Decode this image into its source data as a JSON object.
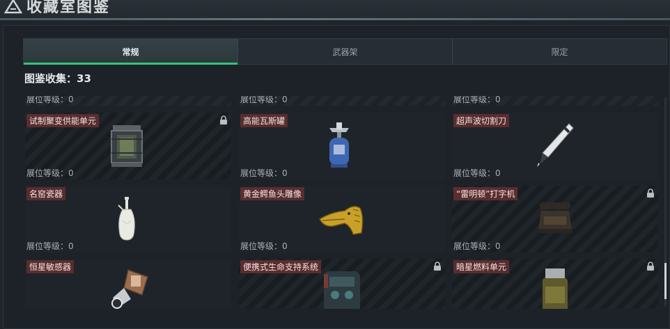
{
  "header": {
    "title": "收藏室图鉴"
  },
  "tabs": [
    {
      "label": "常规",
      "active": true
    },
    {
      "label": "武器架",
      "active": false
    },
    {
      "label": "限定",
      "active": false
    }
  ],
  "collection_count": "图鉴收集：33",
  "level_prefix": "展位等级：",
  "accent_color": "#36c47d",
  "label_color": "#5a2d2e",
  "partial_row": [
    {
      "level": "0"
    },
    {
      "level": "0"
    },
    {
      "level": "0"
    }
  ],
  "items": [
    {
      "name": "试制聚变供能单元",
      "level": "0",
      "locked": true,
      "icon": "fusion-power-unit-icon"
    },
    {
      "name": "高能瓦斯罐",
      "level": "0",
      "locked": false,
      "icon": "gas-canister-icon"
    },
    {
      "name": "超声波切割刀",
      "level": "0",
      "locked": false,
      "icon": "ultrasonic-cutter-icon"
    },
    {
      "name": "名窑瓷器",
      "level": "0",
      "locked": false,
      "icon": "porcelain-vase-icon"
    },
    {
      "name": "黄金鳄鱼头雕像",
      "level": "0",
      "locked": false,
      "icon": "golden-crocodile-head-icon"
    },
    {
      "name": "“雷明顿”打字机",
      "level": "0",
      "locked": true,
      "icon": "typewriter-icon"
    },
    {
      "name": "恒星敏感器",
      "level": "",
      "locked": false,
      "icon": "star-sensor-icon"
    },
    {
      "name": "便携式生命支持系统",
      "level": "",
      "locked": true,
      "icon": "life-support-system-icon"
    },
    {
      "name": "暗星燃料单元",
      "level": "",
      "locked": true,
      "icon": "dark-star-fuel-cell-icon"
    }
  ]
}
